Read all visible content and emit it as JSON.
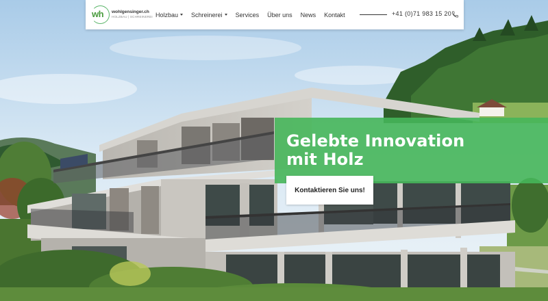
{
  "header": {
    "logo": {
      "name": "wohlgensinger.ch",
      "tagline": "HOLZBAU | SCHREINEREI",
      "mark": "wh"
    },
    "nav": [
      {
        "label": "Holzbau",
        "dropdown": true
      },
      {
        "label": "Schreinerei",
        "dropdown": true
      },
      {
        "label": "Services",
        "dropdown": false
      },
      {
        "label": "Über uns",
        "dropdown": false
      },
      {
        "label": "News",
        "dropdown": false
      },
      {
        "label": "Kontakt",
        "dropdown": false
      }
    ],
    "phone": "+41 (0)71 983 15 20",
    "phone_icon": "phone-icon"
  },
  "hero": {
    "title_line1": "Gelebte Innovation",
    "title_line2": "mit Holz",
    "cta_label": "Kontaktieren Sie uns!"
  },
  "colors": {
    "brand_green": "#46b65a",
    "logo_green": "#4a9c3e",
    "header_bg": "#ffffff",
    "sky": "#cfe3f3"
  }
}
